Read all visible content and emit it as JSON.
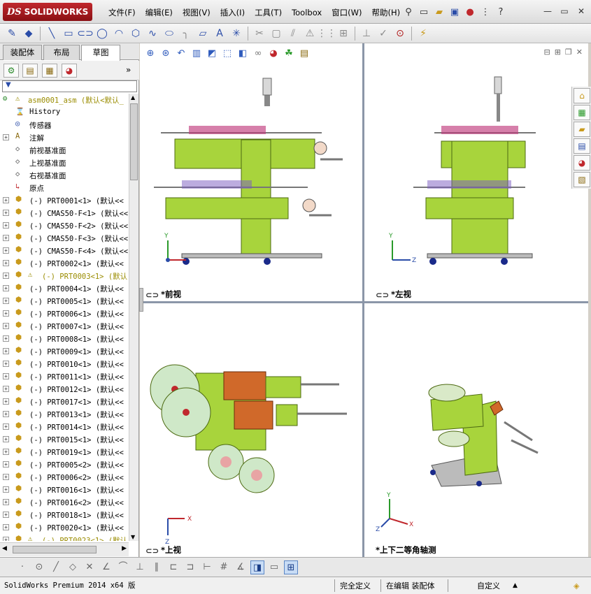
{
  "app": {
    "brand": "SOLIDWORKS",
    "brand_prefix": "DS"
  },
  "menu": [
    "文件(F)",
    "编辑(E)",
    "视图(V)",
    "插入(I)",
    "工具(T)",
    "Toolbox",
    "窗口(W)",
    "帮助(H)"
  ],
  "panel_tabs": [
    "装配体",
    "布局",
    "草图"
  ],
  "active_panel_tab": "草图",
  "tree": {
    "root": "asm0001_asm  (默认<默认_",
    "items": [
      {
        "label": "History",
        "type": "history"
      },
      {
        "label": "传感器",
        "type": "sensor"
      },
      {
        "label": "注解",
        "type": "annotation",
        "expand": true
      },
      {
        "label": "前视基准面",
        "type": "plane"
      },
      {
        "label": "上视基准面",
        "type": "plane"
      },
      {
        "label": "右视基准面",
        "type": "plane"
      },
      {
        "label": "原点",
        "type": "origin"
      },
      {
        "label": "(-) PRT0001<1> (默认<<",
        "type": "part"
      },
      {
        "label": "(-) CMAS50-F<1> (默认<<",
        "type": "part"
      },
      {
        "label": "(-) CMAS50-F<2> (默认<<",
        "type": "part"
      },
      {
        "label": "(-) CMAS50-F<3> (默认<<",
        "type": "part"
      },
      {
        "label": "(-) CMAS50-F<4> (默认<<",
        "type": "part"
      },
      {
        "label": "(-) PRT0002<1> (默认<<",
        "type": "part"
      },
      {
        "label": "(-) PRT0003<1> (默认",
        "type": "part",
        "warn": true
      },
      {
        "label": "(-) PRT0004<1> (默认<<",
        "type": "part"
      },
      {
        "label": "(-) PRT0005<1> (默认<<",
        "type": "part"
      },
      {
        "label": "(-) PRT0006<1> (默认<<",
        "type": "part"
      },
      {
        "label": "(-) PRT0007<1> (默认<<",
        "type": "part"
      },
      {
        "label": "(-) PRT0008<1> (默认<<",
        "type": "part"
      },
      {
        "label": "(-) PRT0009<1> (默认<<",
        "type": "part"
      },
      {
        "label": "(-) PRT0010<1> (默认<<",
        "type": "part"
      },
      {
        "label": "(-) PRT0011<1> (默认<<",
        "type": "part"
      },
      {
        "label": "(-) PRT0012<1> (默认<<",
        "type": "part"
      },
      {
        "label": "(-) PRT0017<1> (默认<<",
        "type": "part"
      },
      {
        "label": "(-) PRT0013<1> (默认<<",
        "type": "part"
      },
      {
        "label": "(-) PRT0014<1> (默认<<",
        "type": "part"
      },
      {
        "label": "(-) PRT0015<1> (默认<<",
        "type": "part"
      },
      {
        "label": "(-) PRT0019<1> (默认<<",
        "type": "part"
      },
      {
        "label": "(-) PRT0005<2> (默认<<",
        "type": "part"
      },
      {
        "label": "(-) PRT0006<2> (默认<<",
        "type": "part"
      },
      {
        "label": "(-) PRT0016<1> (默认<<",
        "type": "part"
      },
      {
        "label": "(-) PRT0016<2> (默认<<",
        "type": "part"
      },
      {
        "label": "(-) PRT0018<1> (默认<<",
        "type": "part"
      },
      {
        "label": "(-) PRT0020<1> (默认<<",
        "type": "part"
      },
      {
        "label": "(-) PRT0023<1> (默认",
        "type": "part",
        "warn": true
      }
    ]
  },
  "viewports": {
    "front": "*前视",
    "left": "*左视",
    "top": "*上视",
    "iso": "*上下二等角轴测"
  },
  "axes": {
    "x": "X",
    "y": "Y",
    "z": "Z"
  },
  "status": {
    "product": "SolidWorks Premium 2014 x64 版",
    "definition": "完全定义",
    "mode": "在编辑 装配体",
    "units": "自定义"
  },
  "colors": {
    "machine_green": "#a8d43c",
    "accent_red": "#c0282d",
    "viewport_border": "#8b96a8"
  }
}
